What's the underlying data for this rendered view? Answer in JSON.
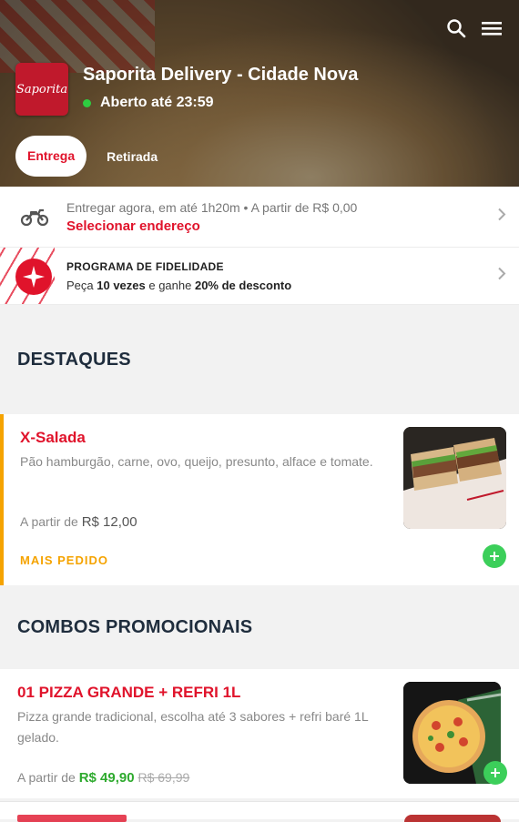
{
  "header": {
    "store_name": "Saporita Delivery - Cidade Nova",
    "status": "Aberto até 23:59",
    "logo_text": "Saporita",
    "tabs": [
      {
        "label": "Entrega",
        "active": true
      },
      {
        "label": "Retirada",
        "active": false
      }
    ],
    "icons": [
      "search-icon",
      "menu-icon"
    ]
  },
  "delivery": {
    "line1": "Entregar agora, em até 1h20m  •  A partir de R$ 0,00",
    "action": "Selecionar endereço",
    "icon": "motorcycle-icon"
  },
  "loyalty": {
    "title": "PROGRAMA DE FIDELIDADE",
    "text_prefix": "Peça ",
    "text_bold1": "10 vezes",
    "text_mid": " e ganhe ",
    "text_bold2": "20% de desconto",
    "icon": "star-badge-icon"
  },
  "sections": [
    {
      "title": "DESTAQUES",
      "products": [
        {
          "name": "X-Salada",
          "description": "Pão hamburgão, carne, ovo, queijo, presunto, alface e tomate.",
          "price_prefix": "A partir de ",
          "price": "R$ 12,00",
          "tag": "MAIS PEDIDO"
        }
      ]
    },
    {
      "title": "COMBOS PROMOCIONAIS",
      "products": [
        {
          "name": "01 PIZZA GRANDE + REFRI 1L",
          "description": "Pizza grande tradicional, escolha até 3 sabores + refri baré 1L gelado.",
          "price_prefix": "A partir de ",
          "price": "R$ 49,90",
          "old_price": "R$ 69,99"
        }
      ]
    }
  ],
  "colors": {
    "brand_red": "#e0132b",
    "open_green": "#2ecc40",
    "add_green": "#3ccf5a",
    "tag_orange": "#f5a300"
  }
}
